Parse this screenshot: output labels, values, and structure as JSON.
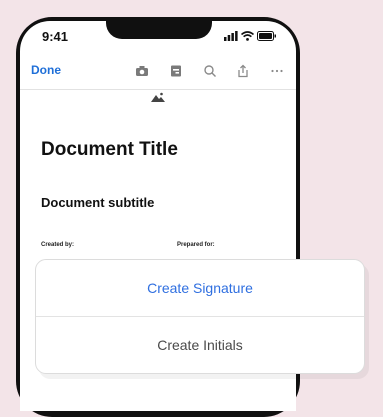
{
  "status_bar": {
    "time": "9:41",
    "icons": [
      "signal-icon",
      "wifi-icon",
      "battery-icon"
    ]
  },
  "toolbar": {
    "done_label": "Done",
    "tools": [
      "camera-icon",
      "signature-icon",
      "search-icon",
      "share-icon",
      "more-icon"
    ],
    "accent": "#1f6fd8"
  },
  "document": {
    "image_icon": "image-icon",
    "title": "Document Title",
    "subtitle": "Document subtitle",
    "created_by_label": "Created by:",
    "prepared_for_label": "Prepared for:"
  },
  "action_sheet": {
    "create_signature": "Create Signature",
    "create_initials": "Create Initials",
    "primary_color": "#2f6fe0"
  }
}
